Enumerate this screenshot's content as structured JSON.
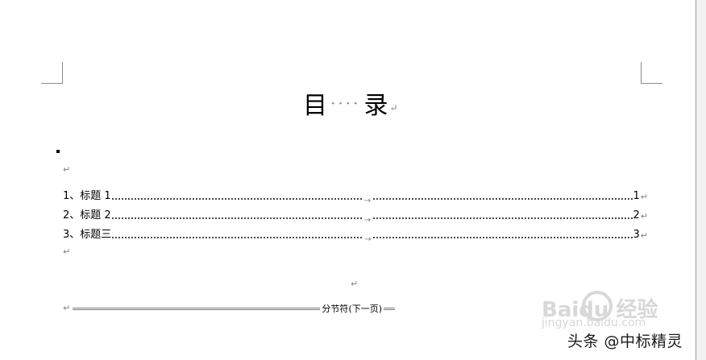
{
  "document": {
    "title_left": "目",
    "title_dots": "····",
    "title_right": "录",
    "paragraph_mark": "↵",
    "tab_arrow": "→",
    "toc": [
      {
        "label": "1、标题 1",
        "page": "1"
      },
      {
        "label": "2、标题 2",
        "page": "2"
      },
      {
        "label": "3、标题三",
        "page": "3"
      }
    ],
    "section_break": "分节符(下一页)"
  },
  "watermark": {
    "brand": "Baidu 经验",
    "site": "jingyan.baidu.com"
  },
  "source_label": "头条 @中标精灵"
}
